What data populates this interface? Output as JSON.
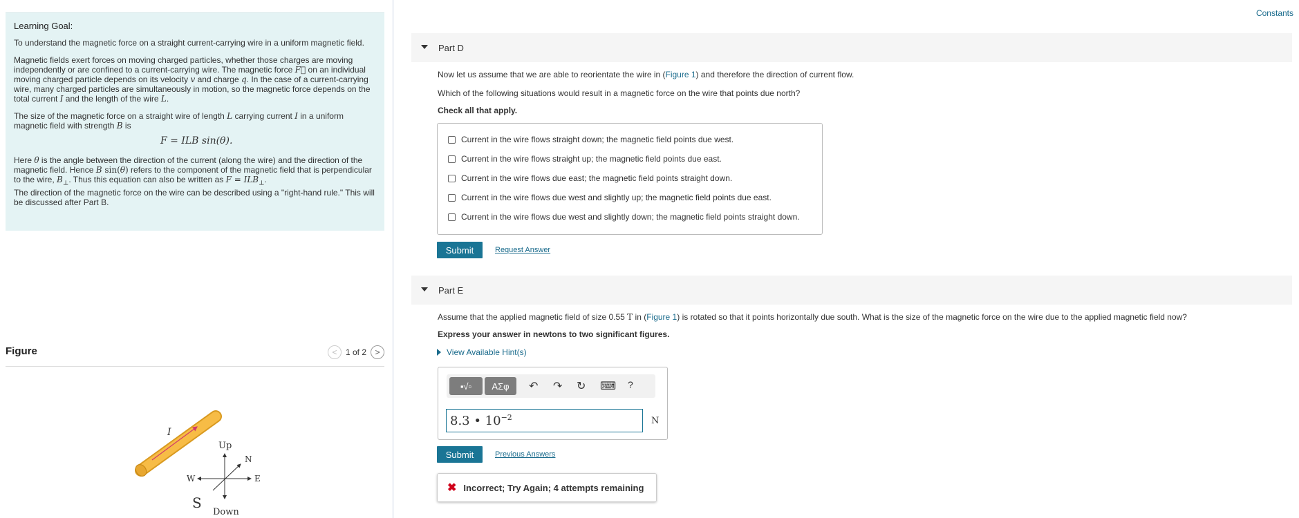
{
  "learning_goal": {
    "title": "Learning Goal:",
    "intro": "To understand the magnetic force on a straight current-carrying wire in a uniform magnetic field.",
    "p1_a": "Magnetic fields exert forces on moving charged particles, whether those charges are moving independently or are confined to a current-carrying wire. The magnetic force ",
    "p1_b": " on an individual moving charged particle depends on its velocity ",
    "p1_c": " and charge ",
    "p1_d": ". In the case of a current-carrying wire, many charged particles are simultaneously in motion, so the magnetic force depends on the total current ",
    "p1_e": " and the length of the wire ",
    "p2_a": "The size of the magnetic force on a straight wire of length ",
    "p2_b": " carrying current ",
    "p2_c": " in a uniform magnetic field with strength ",
    "p2_d": " is",
    "equation": "F = ILB sin(θ).",
    "p3_a": "Here ",
    "p3_b": " is the angle between the direction of the current (along the wire) and the direction of the magnetic field. Hence ",
    "p3_c": " refers to the component of the magnetic field that is perpendicular to the wire, ",
    "p3_d": ". Thus this equation can also be written as ",
    "p3_e": "The direction of the magnetic force on the wire can be described using a \"right-hand rule.\" This will be discussed after Part B."
  },
  "figure": {
    "title": "Figure",
    "page": "1 of 2",
    "labels": {
      "current": "I",
      "up": "Up",
      "down": "Down",
      "north": "N",
      "south": "S",
      "east": "E",
      "west": "W"
    },
    "rod_color": "#f5b843"
  },
  "constants_link": "Constants",
  "part_d": {
    "title": "Part D",
    "text1_a": "Now let us assume that we are able to reorientate the wire in (",
    "text1_link": "Figure 1",
    "text1_b": ") and therefore the direction of current flow.",
    "question": "Which of the following situations would result in a magnetic force on the wire that points due north?",
    "instruction": "Check all that apply.",
    "choices": [
      "Current in the wire flows straight down; the magnetic field points due west.",
      "Current in the wire flows straight up; the magnetic field points due east.",
      "Current in the wire flows due east; the magnetic field points straight down.",
      "Current in the wire flows due west and slightly up; the magnetic field points due east.",
      "Current in the wire flows due west and slightly down; the magnetic field points straight down."
    ],
    "submit": "Submit",
    "request_answer": "Request Answer"
  },
  "part_e": {
    "title": "Part E",
    "text_a": "Assume that the applied magnetic field of size 0.55 ",
    "text_unit": "T",
    "text_b": " in (",
    "text_link": "Figure 1",
    "text_c": ") is rotated so that it points horizontally due south. What is the size of the magnetic force on the wire due to the applied magnetic field now?",
    "instruction": "Express your answer in newtons to two significant figures.",
    "hints": "View Available Hint(s)",
    "toolbar": {
      "templates": "▪√▫",
      "greek": "ΑΣφ",
      "undo": "↶",
      "redo": "↷",
      "reset": "↻",
      "keyboard": "⌨",
      "help": "?"
    },
    "answer_base": "8.3 • 10",
    "answer_exp": "−2",
    "unit": "N",
    "submit": "Submit",
    "previous_answers": "Previous Answers",
    "feedback": "Incorrect; Try Again; 4 attempts remaining"
  }
}
